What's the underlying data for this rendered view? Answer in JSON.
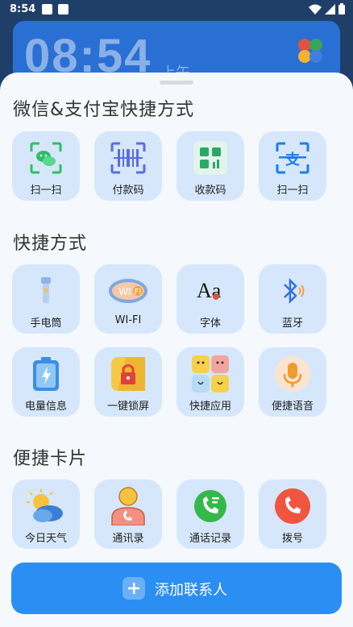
{
  "status_bar": {
    "time": "8:54"
  },
  "background": {
    "clock": "08:54",
    "meridiem": "上午"
  },
  "sections": {
    "wechat_alipay": {
      "title": "微信&支付宝快捷方式",
      "items": [
        {
          "label": "扫一扫",
          "icon": "wechat-scan-icon"
        },
        {
          "label": "付款码",
          "icon": "barcode-icon"
        },
        {
          "label": "收款码",
          "icon": "qr-receive-icon"
        },
        {
          "label": "扫一扫",
          "icon": "alipay-scan-icon"
        }
      ]
    },
    "shortcuts": {
      "title": "快捷方式",
      "items": [
        {
          "label": "手电筒",
          "icon": "flashlight-icon"
        },
        {
          "label": "WI-FI",
          "icon": "wifi-icon"
        },
        {
          "label": "字体",
          "icon": "font-icon",
          "glyph": "Aa"
        },
        {
          "label": "蓝牙",
          "icon": "bluetooth-icon"
        },
        {
          "label": "电量信息",
          "icon": "battery-icon"
        },
        {
          "label": "一键锁屏",
          "icon": "lock-icon"
        },
        {
          "label": "快捷应用",
          "icon": "apps-icon"
        },
        {
          "label": "便捷语音",
          "icon": "microphone-icon"
        }
      ]
    },
    "cards": {
      "title": "便捷卡片",
      "items": [
        {
          "label": "今日天气",
          "icon": "weather-icon"
        },
        {
          "label": "通讯录",
          "icon": "contacts-icon"
        },
        {
          "label": "通话记录",
          "icon": "call-log-icon"
        },
        {
          "label": "拨号",
          "icon": "dialer-icon"
        }
      ]
    }
  },
  "add_contact_button": {
    "label": "添加联系人",
    "icon": "plus-icon"
  },
  "colors": {
    "sheet": "#f5f8fc",
    "tile": "#d6e7fb",
    "primary": "#2b8ef3"
  }
}
